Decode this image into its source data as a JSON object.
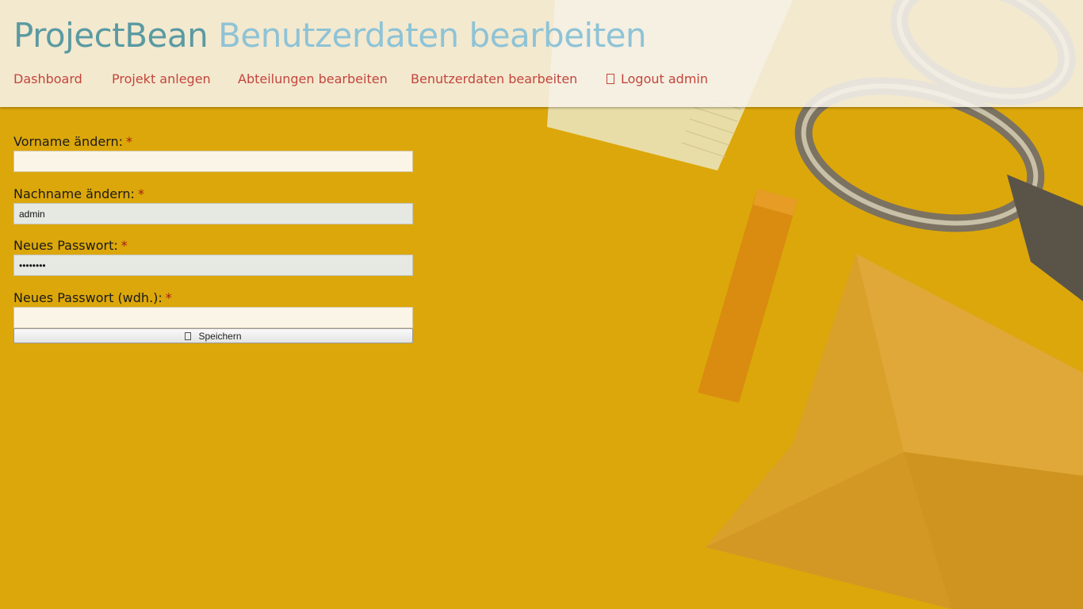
{
  "header": {
    "brand": "ProjectBean",
    "page_title": "Benutzerdaten bearbeiten"
  },
  "nav": {
    "items": [
      {
        "label": "Dashboard"
      },
      {
        "label": "Projekt anlegen"
      },
      {
        "label": "Abteilungen bearbeiten"
      },
      {
        "label": "Benutzerdaten bearbeiten"
      },
      {
        "label": "Logout admin",
        "icon": "logout-icon"
      }
    ]
  },
  "form": {
    "required_marker": "*",
    "fields": [
      {
        "label": "Vorname ändern:",
        "value": "",
        "type": "text"
      },
      {
        "label": "Nachname ändern:",
        "value": "admin",
        "type": "text"
      },
      {
        "label": "Neues Passwort:",
        "value": "********",
        "type": "password"
      },
      {
        "label": "Neues Passwort (wdh.):",
        "value": "",
        "type": "password"
      }
    ],
    "submit": {
      "label": "Speichern",
      "icon": "save-icon"
    }
  },
  "colors": {
    "brand": "#5a9aa2",
    "page_title": "#8ec3d6",
    "nav_link": "#c3453c",
    "required": "#a51c15",
    "background": "#dca70a"
  }
}
